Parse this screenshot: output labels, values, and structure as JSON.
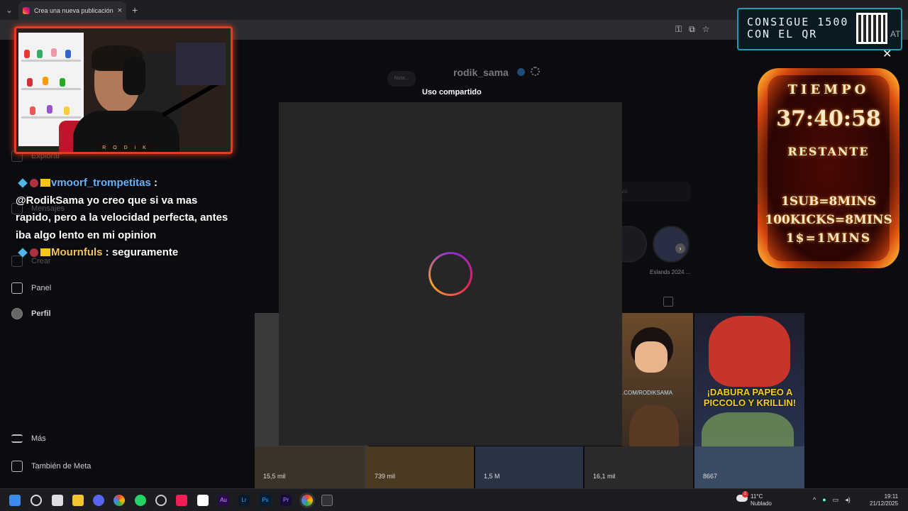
{
  "browser": {
    "tab_title": "Crea una nueva publicación • In",
    "new_tab": "+",
    "tab_close": "×",
    "tab_menu": "⌄"
  },
  "sidebar": {
    "items": [
      {
        "label": "Explorar"
      },
      {
        "label": "Mensajes"
      },
      {
        "label": "Crear"
      },
      {
        "label": "Panel"
      },
      {
        "label": "Perfil"
      },
      {
        "label": "Más"
      },
      {
        "label": "También de Meta"
      }
    ]
  },
  "profile": {
    "username": "rodik_sama",
    "note": "Nota..."
  },
  "modal": {
    "title": "Uso compartido"
  },
  "highlights": {
    "label": "Eslands 2024 ..."
  },
  "grid": {
    "views": [
      "15,5 mil",
      "739 mil",
      "1,5 M",
      "16,1 mil",
      "8667"
    ],
    "tile_texts": [
      "¡DABURA PAPEO A PICCOLO Y KRILLIN!",
      ".COM/RODIKSAMA"
    ]
  },
  "webcam": {
    "name": "R O D i K"
  },
  "chat": {
    "messages": [
      {
        "user": "vmoorf_trompetitas",
        "sep": " :",
        "text": "@RodikSama yo creo que si va mas rapido, pero a la velocidad perfecta, antes iba algo lento en mi opinion"
      },
      {
        "user": "Mournfuls",
        "sep": " :",
        "text": "seguramente"
      }
    ]
  },
  "stream_overlay": {
    "qr_line1": "CONSIGUE 1500",
    "qr_line2": "CON EL QR",
    "qr_tail": "AT",
    "close": "✕",
    "timer_label": "TIEMPO",
    "timer_value": "37:40:58",
    "timer_sub": "RESTANTE",
    "rule1": "1SUB=8MINS",
    "rule2": "100KICKS=8MINS",
    "rule3": "1$=1MINS"
  },
  "taskbar": {
    "weather_temp": "11°C",
    "weather_desc": "Nublado",
    "weather_badge": "2",
    "time": "19:11",
    "date": "21/12/2025"
  }
}
